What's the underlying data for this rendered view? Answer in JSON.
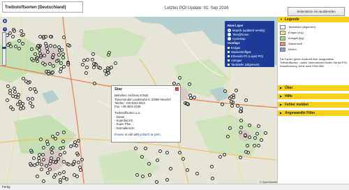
{
  "header": {
    "title": "Treibstoffsorten (Deutschland)",
    "update_label": "Letztes POI Update:",
    "update_date": "01. Sep 2016",
    "hide_sidebar": "Seitenleiste ein-/ausblenden"
  },
  "layers": {
    "base_heading": "Base Layer",
    "base": [
      {
        "label": "Mapnik (updated weekly)",
        "checked": true
      },
      {
        "label": "Tiles@home",
        "checked": false
      },
      {
        "label": "CycleMap",
        "checked": false
      }
    ],
    "overlay_heading": "Overlays",
    "overlays": [
      {
        "label": "Erdgas"
      },
      {
        "label": "Wasserstoffgas"
      },
      {
        "label": "Ethanol/LPG (Liquid PG)"
      },
      {
        "label": "Autogas"
      },
      {
        "label": "Tankstelle (allgemein)"
      }
    ]
  },
  "popup": {
    "title": "Star",
    "operator": "Betreiber: Andreas Schütz",
    "address": "Travemünder Landstraße 6, 23669 Neudorf",
    "phone": "Telefon: +49 4503 2013",
    "fax": "Fax: +49 4503 4439",
    "fuel_heading": "Treibstoffsorten u.a.:",
    "fuels": [
      "- Diesel",
      "- Superbenzin",
      "- Super Plus",
      "- Normalbenzin"
    ],
    "browse_prefix": "browse",
    "browse_text": " or edit with ",
    "potlatch": "potlatch",
    "or": " or ",
    "josm": "josm",
    "close": "x"
  },
  "map": {
    "attribution": "© OpenStreetMap contributors"
  },
  "sidebar": {
    "legend": "Legende",
    "legend_items": [
      {
        "label": "Tankstellen (allgemein)",
        "color": "#ffffff"
      },
      {
        "label": "Erdgas (cng)",
        "color": "#e8e88a"
      },
      {
        "label": "Autogas (lpg)",
        "color": "#9bd88a"
      },
      {
        "label": "Wasserstoff",
        "color": "#f28a6c"
      },
      {
        "label": "Elektro",
        "color": "#7ea2d9"
      }
    ],
    "legend_note": "Die Farben geben Auskunft über ausgewählte Treibstoffsorten - weiter Informationen finden Sie bei POI-Klassifizierung, siehe auch OSM-Wiki.",
    "sections": [
      "Über",
      "Hilfe",
      "Fehler melden",
      "Angewandte Filter"
    ]
  },
  "statusbar": {
    "text": "Fertig",
    "right": ""
  },
  "colors": {
    "header_yellow": "#f7d118",
    "layer_blue": "#1d3c97"
  }
}
